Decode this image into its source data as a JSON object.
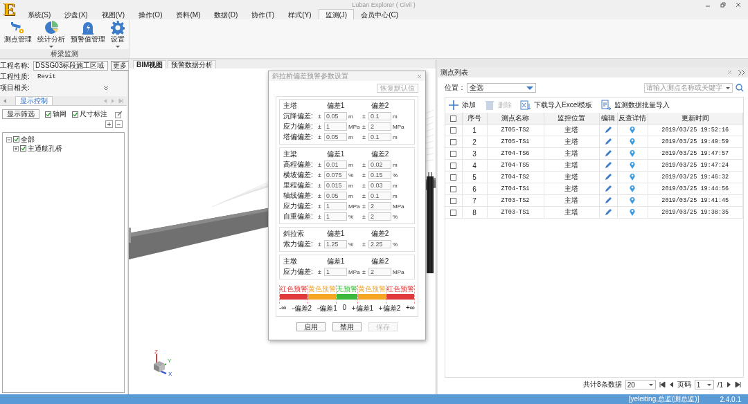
{
  "app": {
    "logo": "E",
    "title": "Luban Explorer ( Civil )"
  },
  "menu_tabs": [
    {
      "label": "系统(S)",
      "selected": false
    },
    {
      "label": "沙盘(X)",
      "selected": false
    },
    {
      "label": "视图(V)",
      "selected": false
    },
    {
      "label": "操作(O)",
      "selected": false
    },
    {
      "label": "资料(M)",
      "selected": false
    },
    {
      "label": "数据(D)",
      "selected": false
    },
    {
      "label": "协作(T)",
      "selected": false
    },
    {
      "label": "样式(Y)",
      "selected": false
    },
    {
      "label": "监测(J)",
      "selected": true
    },
    {
      "label": "会员中心(C)",
      "selected": false
    }
  ],
  "ribbon": {
    "group_label": "桥梁监测",
    "buttons": [
      {
        "label": "测点管理",
        "kind": "camera",
        "dropdown": false
      },
      {
        "label": "统计分析",
        "kind": "pie",
        "dropdown": true
      },
      {
        "label": "预警值管理",
        "kind": "alarm",
        "dropdown": false
      },
      {
        "label": "设置",
        "kind": "gear",
        "dropdown": true
      }
    ]
  },
  "project_panel": {
    "fields": [
      {
        "label": "工程名称:",
        "kind": "select",
        "value": "DSSG03标段施工区域",
        "button": "更多"
      },
      {
        "label": "工程性质:",
        "kind": "text",
        "value": "Revit"
      },
      {
        "label": "项目相关:",
        "kind": "collapse"
      }
    ],
    "tab": "显示控制",
    "filter_button": "显示筛选",
    "checks": [
      {
        "label": "轴网",
        "checked": true
      },
      {
        "label": "尺寸标注",
        "checked": true
      }
    ],
    "zoom_buttons": [
      "+",
      "−"
    ],
    "tree": [
      {
        "label": "全部",
        "checked": true,
        "expanded": true,
        "children": [
          {
            "label": "主通航孔桥",
            "checked": true,
            "expanded": false
          }
        ]
      }
    ]
  },
  "view_tabs": [
    {
      "label": "BIM视图",
      "selected": true
    },
    {
      "label": "预警数据分析",
      "selected": false
    }
  ],
  "axes": [
    "Z",
    "Y",
    "X"
  ],
  "dialog": {
    "title": "斜拉桥偏差预警参数设置",
    "restore_button": "恢复默认值",
    "groups": [
      {
        "name": "主塔",
        "headers": [
          "偏差1",
          "偏差2"
        ],
        "rows": [
          {
            "label": "沉降偏差:",
            "values": [
              {
                "sign": "±",
                "value": "0.05",
                "unit": "m"
              },
              {
                "sign": "±",
                "value": "0.1",
                "unit": "m"
              }
            ]
          },
          {
            "label": "应力偏差:",
            "values": [
              {
                "sign": "±",
                "value": "1",
                "unit": "MPa"
              },
              {
                "sign": "±",
                "value": "2",
                "unit": "MPa"
              }
            ]
          },
          {
            "label": "塔偏偏差:",
            "values": [
              {
                "sign": "±",
                "value": "0.05",
                "unit": "m"
              },
              {
                "sign": "±",
                "value": "0.1",
                "unit": "m"
              }
            ]
          }
        ]
      },
      {
        "name": "主梁",
        "headers": [
          "偏差1",
          "偏差2"
        ],
        "rows": [
          {
            "label": "高程偏差:",
            "values": [
              {
                "sign": "±",
                "value": "0.01",
                "unit": "m"
              },
              {
                "sign": "±",
                "value": "0.02",
                "unit": "m"
              }
            ]
          },
          {
            "label": "横坡偏差:",
            "values": [
              {
                "sign": "±",
                "value": "0.075",
                "unit": "%"
              },
              {
                "sign": "±",
                "value": "0.15",
                "unit": "%"
              }
            ]
          },
          {
            "label": "里程偏差:",
            "values": [
              {
                "sign": "±",
                "value": "0.015",
                "unit": "m"
              },
              {
                "sign": "±",
                "value": "0.03",
                "unit": "m"
              }
            ]
          },
          {
            "label": "轴线偏差:",
            "values": [
              {
                "sign": "±",
                "value": "0.05",
                "unit": "m"
              },
              {
                "sign": "±",
                "value": "0.1",
                "unit": "m"
              }
            ]
          },
          {
            "label": "应力偏差:",
            "values": [
              {
                "sign": "±",
                "value": "1",
                "unit": "MPa"
              },
              {
                "sign": "±",
                "value": "2",
                "unit": "MPa"
              }
            ]
          },
          {
            "label": "自重偏差:",
            "values": [
              {
                "sign": "±",
                "value": "1",
                "unit": "%"
              },
              {
                "sign": "±",
                "value": "2",
                "unit": "%"
              }
            ]
          }
        ]
      },
      {
        "name": "斜拉索",
        "headers": [
          "偏差1",
          "偏差2"
        ],
        "rows": [
          {
            "label": "索力偏差:",
            "values": [
              {
                "sign": "±",
                "value": "1.25",
                "unit": "%"
              },
              {
                "sign": "±",
                "value": "2.25",
                "unit": "%"
              }
            ]
          }
        ]
      },
      {
        "name": "主墩",
        "headers": [
          "偏差1",
          "偏差2"
        ],
        "rows": [
          {
            "label": "应力偏差:",
            "values": [
              {
                "sign": "±",
                "value": "1",
                "unit": "MPa"
              },
              {
                "sign": "±",
                "value": "2",
                "unit": "MPa"
              }
            ]
          }
        ]
      }
    ],
    "scale": [
      {
        "label": "红色预警",
        "color": "#e03a3a"
      },
      {
        "label": "黄色预警",
        "color": "#f5a623"
      },
      {
        "label": "无预警",
        "color": "#3cb93c"
      },
      {
        "label": "黄色预警",
        "color": "#f5a623"
      },
      {
        "label": "红色预警",
        "color": "#e03a3a"
      }
    ],
    "ticks": [
      "-∞",
      "-偏差2",
      "-偏差1",
      "0",
      "+偏差1",
      "+偏差2",
      "+∞"
    ],
    "buttons": [
      {
        "label": "启用",
        "disabled": false
      },
      {
        "label": "禁用",
        "disabled": false
      },
      {
        "label": "保存",
        "disabled": true
      }
    ]
  },
  "point_list": {
    "title": "测点列表",
    "location_label": "位置：",
    "location_value": "全选",
    "search_placeholder": "请输入测点名称或关键字",
    "actions": [
      {
        "label": "添加",
        "kind": "add",
        "disabled": false
      },
      {
        "label": "删除",
        "kind": "delete",
        "disabled": true
      },
      {
        "label": "下载导入Excel模板",
        "kind": "excel",
        "disabled": false
      },
      {
        "label": "监测数据批量导入",
        "kind": "import",
        "disabled": false
      }
    ],
    "all_checked": false,
    "columns": [
      "序号",
      "测点名称",
      "监控位置",
      "编辑",
      "反查详情",
      "更新时间"
    ],
    "rows": [
      {
        "index": "1",
        "name": "ZT05-TS2",
        "position": "主塔",
        "time": "2019/03/25 19:52:16",
        "checked": false
      },
      {
        "index": "2",
        "name": "ZT05-TS1",
        "position": "主塔",
        "time": "2019/03/25 19:49:59",
        "checked": false
      },
      {
        "index": "3",
        "name": "ZT04-TS6",
        "position": "主塔",
        "time": "2019/03/25 19:47:57",
        "checked": false
      },
      {
        "index": "4",
        "name": "ZT04-TS5",
        "position": "主塔",
        "time": "2019/03/25 19:47:24",
        "checked": false
      },
      {
        "index": "5",
        "name": "ZT04-TS2",
        "position": "主塔",
        "time": "2019/03/25 19:46:32",
        "checked": false
      },
      {
        "index": "6",
        "name": "ZT04-TS1",
        "position": "主塔",
        "time": "2019/03/25 19:44:56",
        "checked": false
      },
      {
        "index": "7",
        "name": "ZT03-TS2",
        "position": "主塔",
        "time": "2019/03/25 19:41:45",
        "checked": false
      },
      {
        "index": "8",
        "name": "ZT03-TS1",
        "position": "主塔",
        "time": "2019/03/25 19:38:35",
        "checked": false
      }
    ],
    "total": "共计8条数据",
    "page_size": "20",
    "page_label": "页码",
    "page": "1",
    "page_count": "/1"
  },
  "status_bar": {
    "user": "[yeleiting,总监(测总监)]",
    "version": "2.4.0.1"
  }
}
